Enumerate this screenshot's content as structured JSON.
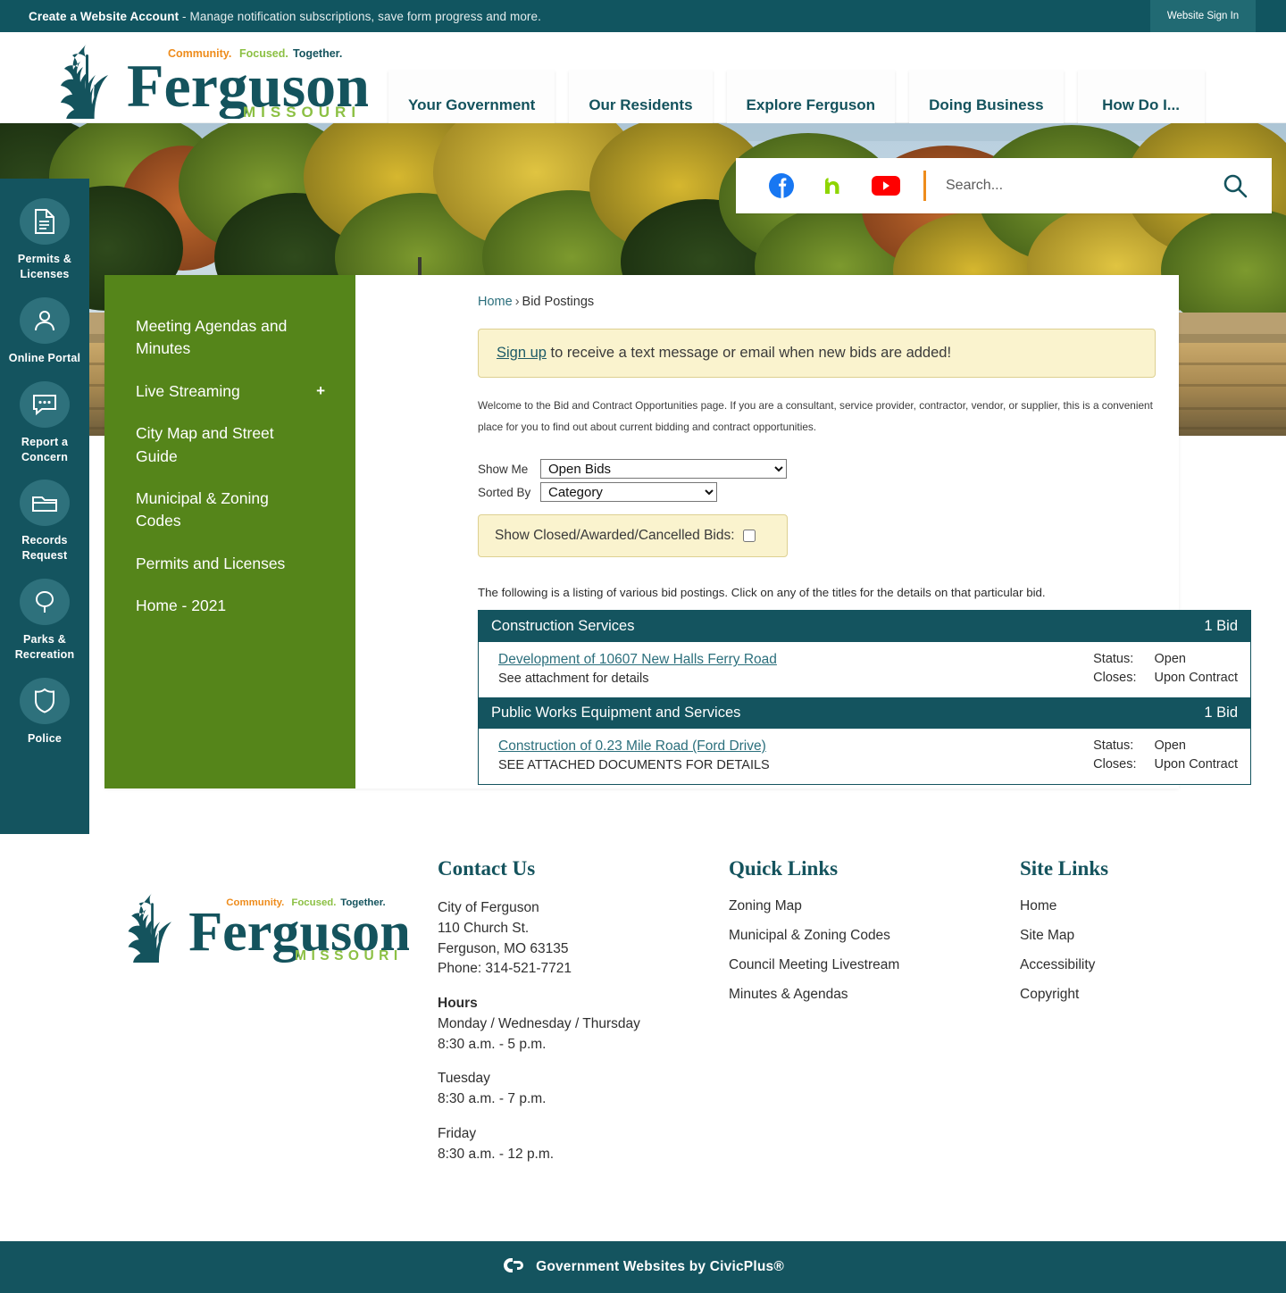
{
  "utility": {
    "account_link": "Create a Website Account",
    "account_tagline": " - Manage notification subscriptions, save form progress and more.",
    "sign_in": "Website Sign In"
  },
  "brand": {
    "name": "Ferguson",
    "state": "MISSOURI",
    "tagline_1": "Community.",
    "tagline_2": "Focused.",
    "tagline_3": "Together.",
    "colors": {
      "teal": "#14535d",
      "green": "#8cc044",
      "orange": "#ee8c1c"
    }
  },
  "mainnav": {
    "items": [
      {
        "label": "Your Government"
      },
      {
        "label": "Our Residents"
      },
      {
        "label": "Explore Ferguson"
      },
      {
        "label": "Doing Business"
      },
      {
        "label": "How Do I..."
      }
    ]
  },
  "rail": {
    "items": [
      {
        "label": "Permits & Licenses",
        "icon": "document-icon"
      },
      {
        "label": "Online Portal",
        "icon": "user-icon"
      },
      {
        "label": "Report a Concern",
        "icon": "chat-bubble-icon"
      },
      {
        "label": "Records Request",
        "icon": "folder-icon"
      },
      {
        "label": "Parks & Recreation",
        "icon": "tree-icon"
      },
      {
        "label": "Police",
        "icon": "police-badge-icon"
      }
    ]
  },
  "search": {
    "placeholder": "Search...",
    "social": [
      {
        "name": "facebook-icon",
        "color": "#1877F2"
      },
      {
        "name": "nextdoor-icon",
        "color": "#8ED500"
      },
      {
        "name": "youtube-icon",
        "color": "#FF0000"
      }
    ]
  },
  "subnav": {
    "items": [
      {
        "label": "Meeting Agendas and Minutes",
        "expandable": ""
      },
      {
        "label": "Live Streaming",
        "expandable": "+"
      },
      {
        "label": "City Map and Street Guide",
        "expandable": ""
      },
      {
        "label": "Municipal & Zoning Codes",
        "expandable": ""
      },
      {
        "label": "Permits and Licenses",
        "expandable": ""
      },
      {
        "label": "Home - 2021",
        "expandable": ""
      }
    ]
  },
  "breadcrumb": {
    "home": "Home",
    "separator": "›",
    "current": "Bid Postings"
  },
  "notice": {
    "link": "Sign up",
    "rest": " to receive a text message or email when new bids are added!"
  },
  "intro": "Welcome to the Bid and Contract Opportunities page. If you are a consultant, service provider, contractor, vendor, or supplier, this is a convenient place for you to find out about current bidding and contract opportunities.",
  "filters": {
    "show_me_label": "Show Me",
    "show_me_value": "Open Bids",
    "show_me_options": [
      "Open Bids"
    ],
    "sorted_by_label": "Sorted By",
    "sorted_by_value": "Category",
    "sorted_by_options": [
      "Category"
    ],
    "closed_label": "Show Closed/Awarded/Cancelled Bids:",
    "closed_checked": false
  },
  "listing_note": "The following is a listing of various bid postings. Click on any of the titles for the details on that particular bid.",
  "bid_table": {
    "status_key": "Status:",
    "closes_key": "Closes:",
    "categories": [
      {
        "name": "Construction Services",
        "count": "1 Bid",
        "bids": [
          {
            "title": "Development of 10607 New Halls Ferry Road",
            "desc": "See attachment for details",
            "status": "Open",
            "closes": "Upon Contract"
          }
        ]
      },
      {
        "name": "Public Works Equipment and Services",
        "count": "1 Bid",
        "bids": [
          {
            "title": "Construction of 0.23 Mile Road (Ford Drive)",
            "desc": "SEE ATTACHED DOCUMENTS FOR DETAILS",
            "status": "Open",
            "closes": "Upon Contract"
          }
        ]
      }
    ]
  },
  "footer": {
    "contact": {
      "heading": "Contact Us",
      "org": "City of Ferguson",
      "street": "110 Church St.",
      "citystate": "Ferguson, MO 63135",
      "phone": "Phone: 314-521-7721",
      "hours_heading": "Hours",
      "hours": [
        "Monday / Wednesday / Thursday",
        "8:30 a.m. - 5 p.m.",
        "Tuesday",
        "8:30 a.m. - 7 p.m.",
        "Friday",
        "8:30 a.m. - 12 p.m."
      ]
    },
    "quick": {
      "heading": "Quick Links",
      "links": [
        "Zoning Map",
        "Municipal & Zoning Codes",
        "Council Meeting Livestream",
        "Minutes & Agendas"
      ]
    },
    "site": {
      "heading": "Site Links",
      "links": [
        "Home",
        "Site Map",
        "Accessibility",
        "Copyright"
      ]
    }
  },
  "civicplus": {
    "text": "Government Websites by CivicPlus®",
    "logo": "cp-logo-icon"
  }
}
